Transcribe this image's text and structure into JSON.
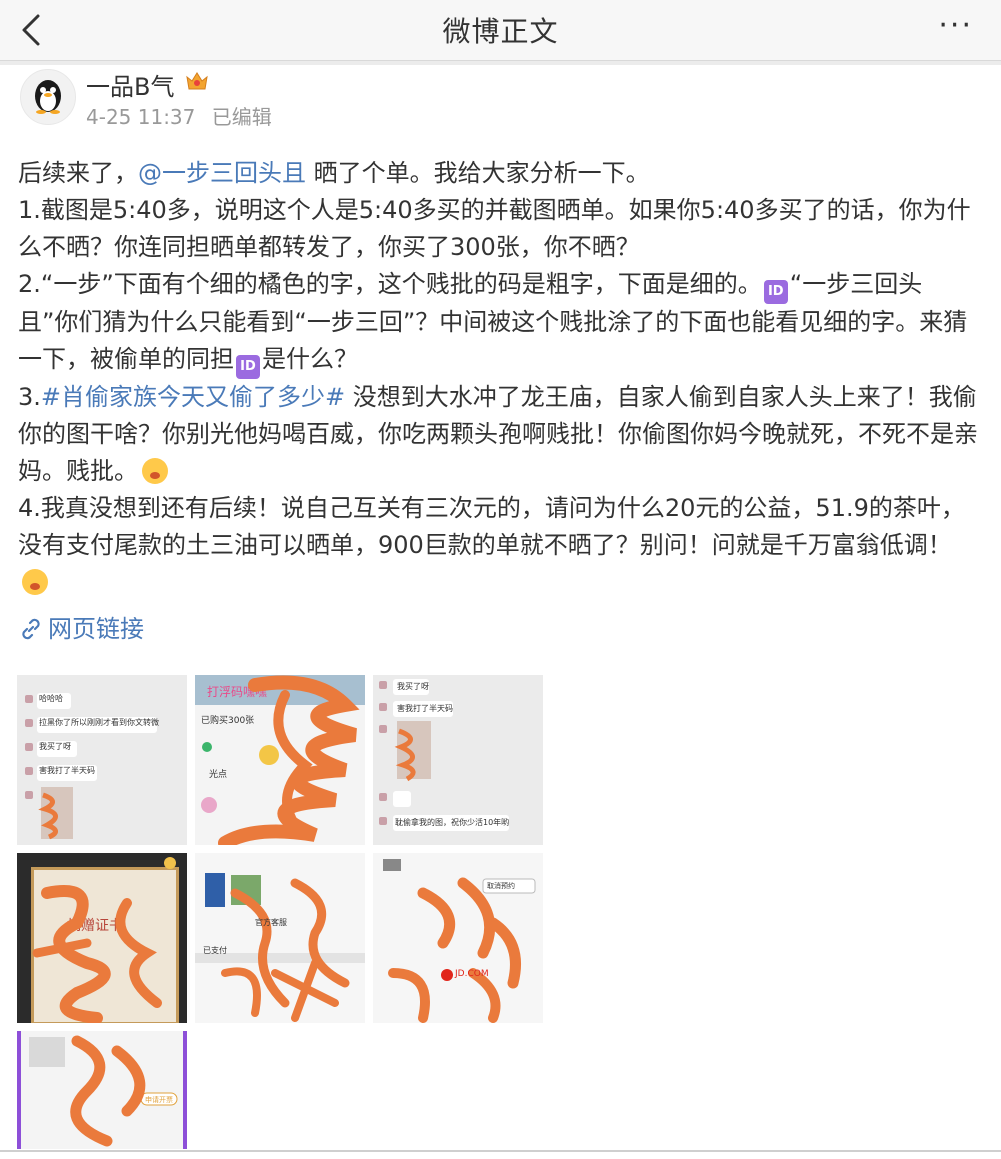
{
  "nav": {
    "title": "微博正文",
    "more": "···"
  },
  "post": {
    "author": "一品B气",
    "time": "4-25 11:37",
    "edited": "已编辑",
    "line1_a": "后续来了，",
    "mention": "@一步三回头且",
    "line1_b": " 晒了个单。我给大家分析一下。",
    "p1": "1.截图是5:40多，说明这个人是5:40多买的并截图晒单。如果你5:40多买了的话，你为什么不晒？你连同担晒单都转发了，你买了300张，你不晒？",
    "p2_a": "2.“一步”下面有个细的橘色的字，这个贱批的码是粗字，下面是细的。",
    "p2_b": "“一步三回头且”你们猜为什么只能看到“一步三回”？中间被这个贱批涂了的下面也能看见细的字。来猜一下，被偷单的同担",
    "p2_c": "是什么？",
    "p3_num": "3.",
    "hashtag": "#肖偷家族今天又偷了多少#",
    "p3_a": " 没想到大水冲了龙王庙，自家人偷到自家人头上来了！我偷你的图干啥？你别光他妈喝百威，你吃两颗头孢啊贱批！你偷图你妈今晚就死，不死不是亲妈。贱批。",
    "p4": "4.我真没想到还有后续！说自己互关有三次元的，请问为什么20元的公益，51.9的茶叶，没有支付尾款的土三油可以晒单，900巨款的单就不晒了？别问！问就是千万富翁低调！",
    "id_badge": "ID",
    "web_link": "网页链接"
  },
  "images": {
    "t1": [
      "哈哈哈",
      "拉黑你了所以刚刚才看到你文转微",
      "我买了呀",
      "害我打了半天码"
    ],
    "t2": [
      "打浮码嘿嘿",
      "已购买300张",
      "光点"
    ],
    "t3": [
      "我买了呀",
      "害我打了半天码",
      "耽偷拿我的图，祝你少活10年哟"
    ],
    "t4": [
      "捐赠证书"
    ],
    "t5": [
      "官方客服",
      "已支付"
    ],
    "t6": [
      "取消预约",
      "JD.COM"
    ],
    "t7": [
      "申请开票"
    ]
  },
  "colors": {
    "scribble": "#ea7a3c",
    "link": "#4a7ab8",
    "id_purple": "#9b6be0"
  }
}
